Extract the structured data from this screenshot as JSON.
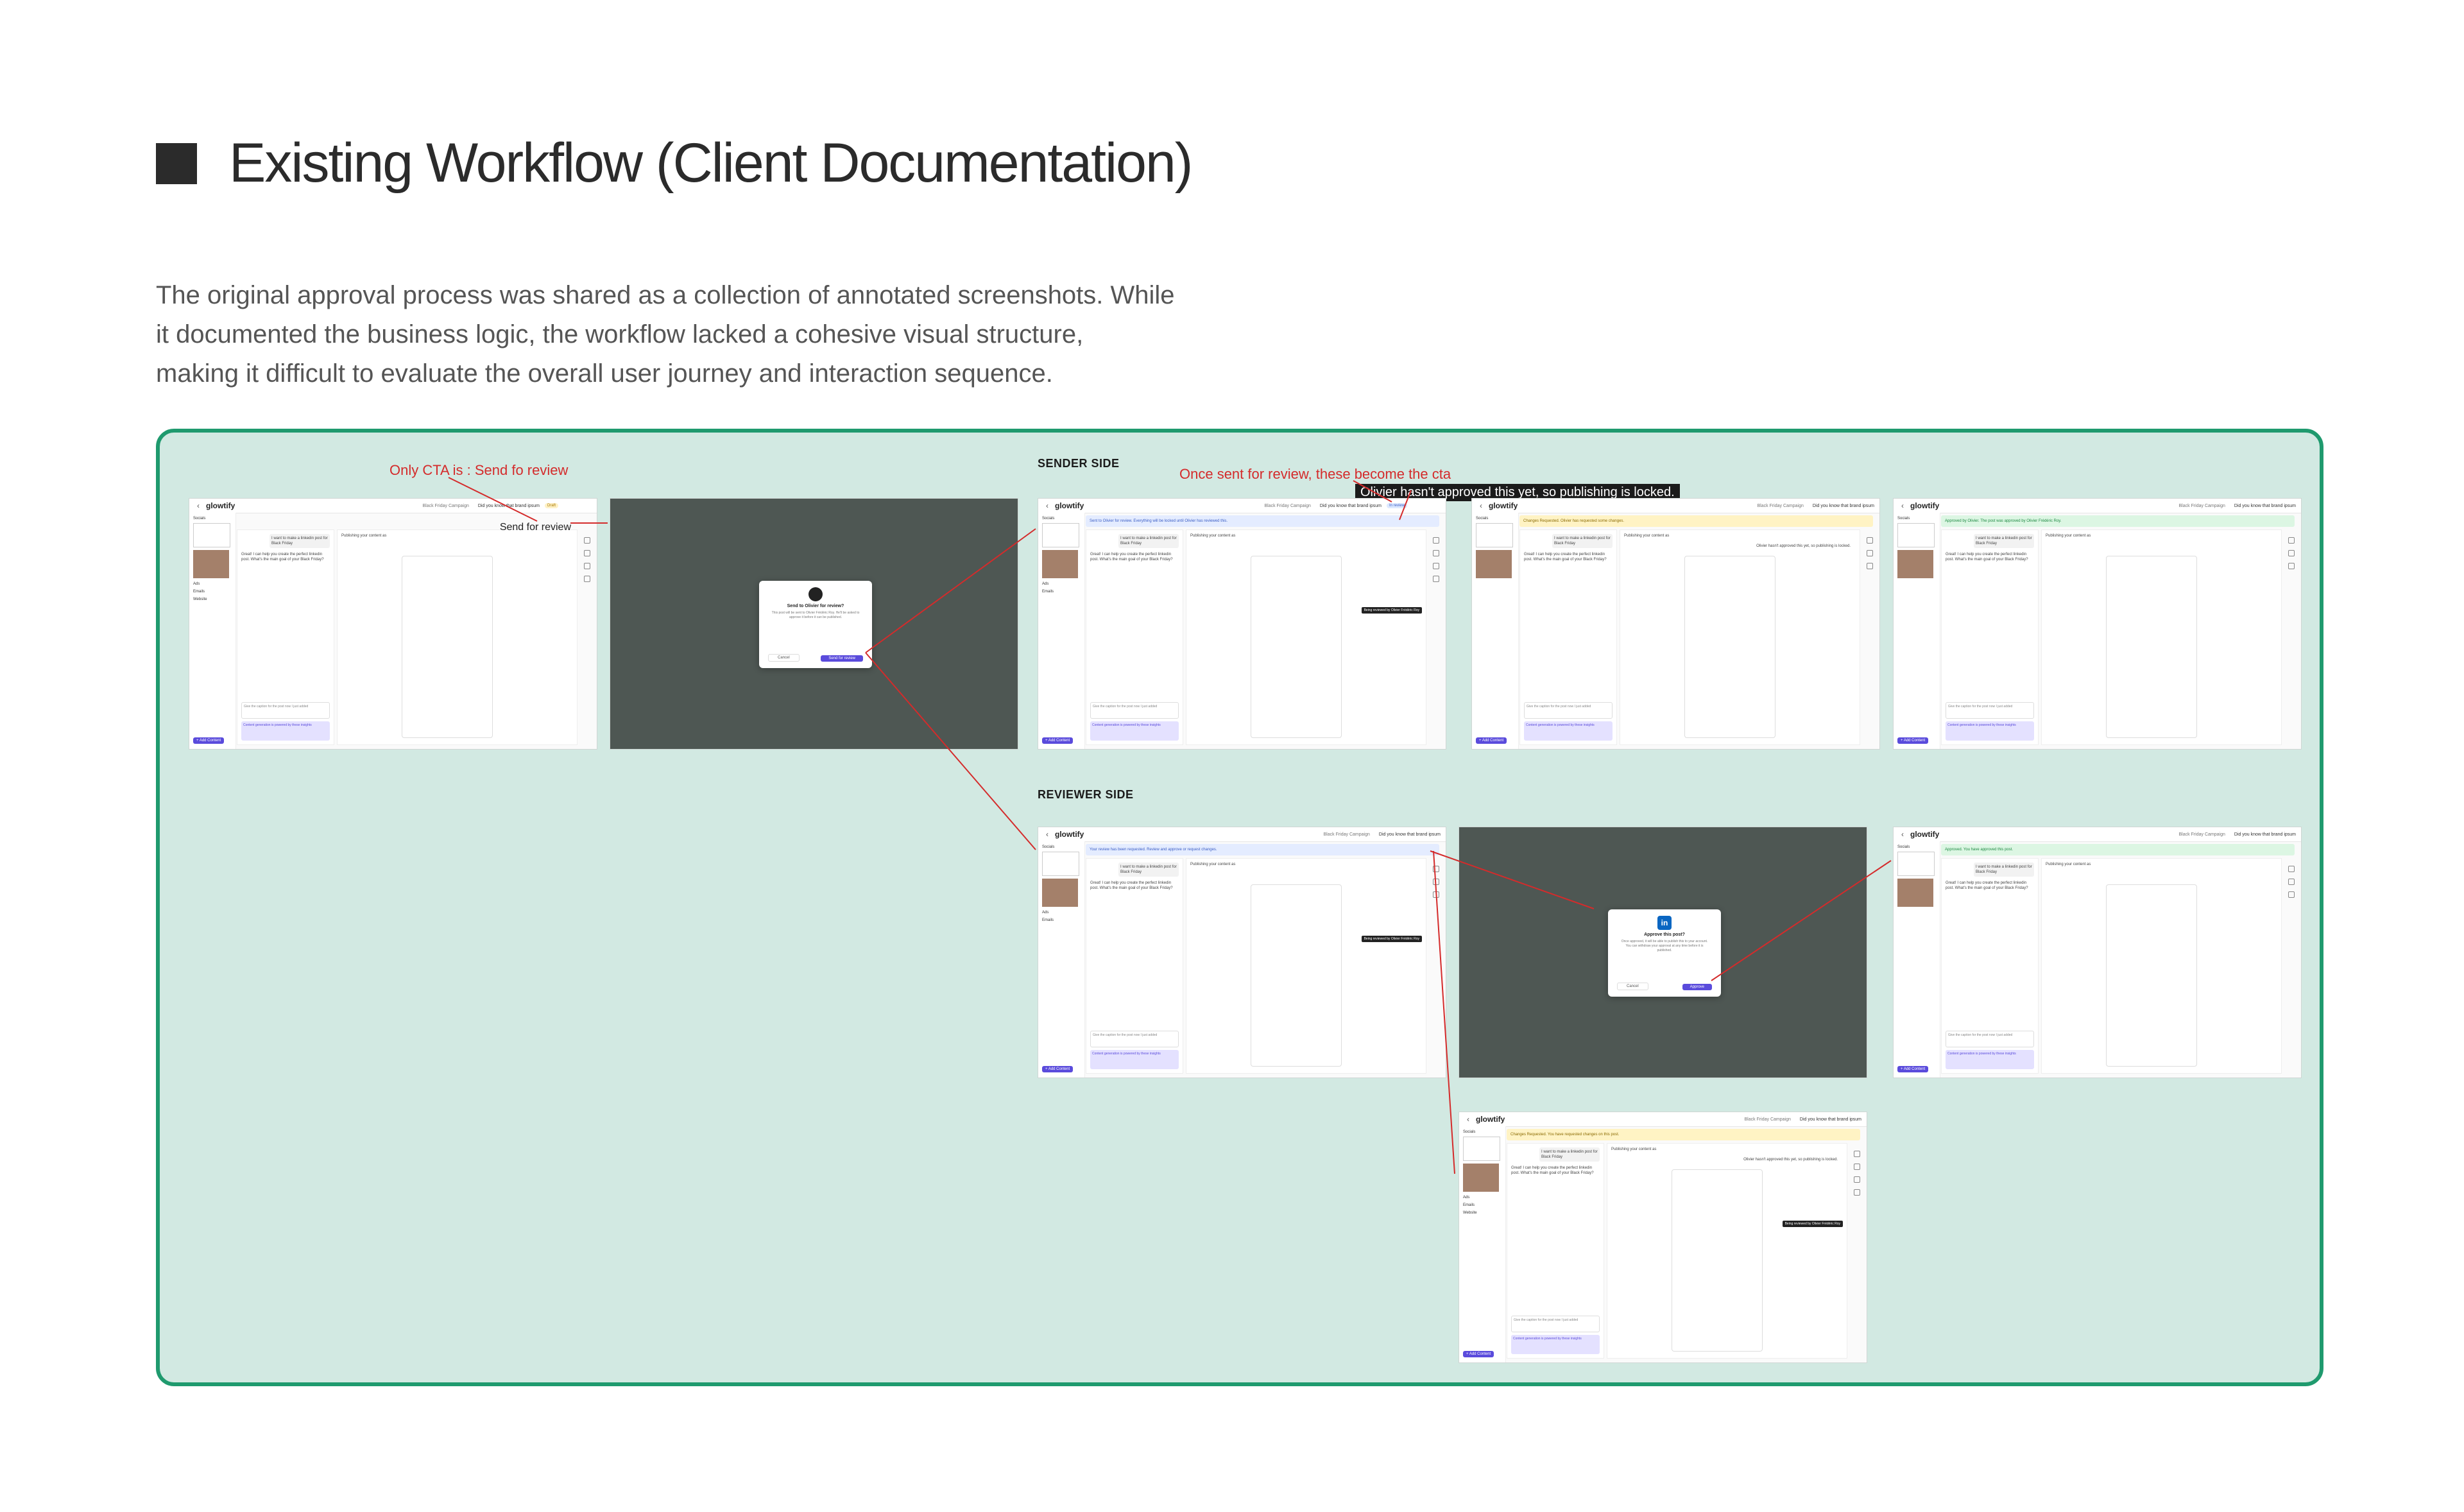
{
  "heading": {
    "title": "Existing Workflow (Client Documentation)"
  },
  "intro": {
    "lines": [
      "The original approval process was shared as a collection of annotated screenshots. While",
      "it documented the business logic, the workflow lacked a cohesive visual structure,",
      "making it difficult to evaluate the overall user journey and interaction sequence."
    ]
  },
  "annotations": {
    "only_cta": "Only CTA is : Send fo review",
    "once_sent": "Once sent for review, these become the cta",
    "locked_note": "Olivier hasn't approved this yet, so publishing is locked."
  },
  "sections": {
    "sender": "SENDER SIDE",
    "reviewer": "REVIEWER SIDE"
  },
  "app": {
    "logo": "glowtify",
    "back": "‹",
    "campaign": "Black Friday Campaign",
    "post_title": "Did you know that brand ipsum",
    "left": {
      "socials": "Socials",
      "ads": "Ads",
      "emails": "Emails",
      "website": "Website",
      "add": "+ Add Content"
    },
    "chat": {
      "user_msg": "I want to make a linkedin post for Black Friday",
      "bot_msg": "Great! I can help you create the perfect linkedin post. What's the main goal of your Black Friday?",
      "input_placeholder": "Give the caption for the post now I just added",
      "tray": "Content generation is powered by these insights"
    },
    "editor": {
      "publishing": "Publishing your content as",
      "locked": "Olivier hasn't approved this yet, so publishing is locked.",
      "tooltip": "Being reviewed by Olivier Frédéric Roy"
    },
    "status": {
      "draft": "Draft",
      "review": "In review",
      "approved": "Approved",
      "changes": "Changes Requested"
    },
    "cta": {
      "send": "Send for review",
      "approve": "Approve",
      "request_changes": "Request changes"
    },
    "banners": {
      "sent": "Sent to Olivier for review. Everything will be locked until Olivier has reviewed this.",
      "changes": "Changes Requested. Olivier has requested some changes.",
      "approved": "Approved by Olivier. The post was approved by Olivier Frédéric Roy.",
      "reviewer_request": "Your review has been requested. Review and approve or request changes.",
      "reviewer_approved": "Approved. You have approved this post.",
      "reviewer_changes": "Changes Requested. You have requested changes on this post."
    }
  },
  "modals": {
    "send": {
      "title": "Send to Olivier for review?",
      "body": "This post will be sent to Olivier Frédéric Roy. He'll be asked to approve it before it can be published.",
      "cancel": "Cancel",
      "confirm": "Send for review"
    },
    "approve": {
      "icon": "in",
      "title": "Approve this post?",
      "body": "Once approved, it will be able to publish this to your account. You can withdraw your approval at any time before it is published.",
      "cancel": "Cancel",
      "confirm": "Approve"
    }
  },
  "colors": {
    "panel_bg": "#d2e9e2",
    "panel_border": "#1f9a6e",
    "annotation": "#d42b2b",
    "brand": "#5a4bdc"
  }
}
